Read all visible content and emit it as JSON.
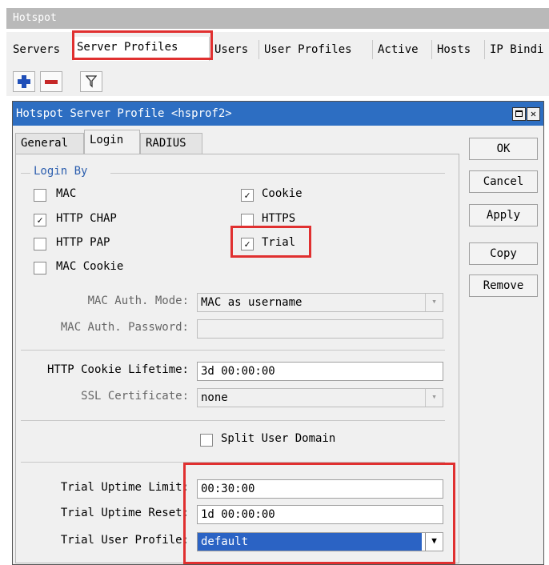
{
  "parent_window": {
    "title": "Hotspot",
    "tabs": [
      "Servers",
      "Server Profiles",
      "Users",
      "User Profiles",
      "Active",
      "Hosts",
      "IP Bindi"
    ],
    "active_tab": "Server Profiles"
  },
  "dialog": {
    "title": "Hotspot Server Profile <hsprof2>",
    "tabs": [
      "General",
      "Login",
      "RADIUS"
    ],
    "active_tab": "Login",
    "buttons": {
      "ok": "OK",
      "cancel": "Cancel",
      "apply": "Apply",
      "copy": "Copy",
      "remove": "Remove"
    }
  },
  "login": {
    "group_label": "Login By",
    "checkboxes": {
      "mac": {
        "label": "MAC",
        "checked": false
      },
      "http_chap": {
        "label": "HTTP CHAP",
        "checked": true
      },
      "http_pap": {
        "label": "HTTP PAP",
        "checked": false
      },
      "mac_cookie": {
        "label": "MAC Cookie",
        "checked": false
      },
      "cookie": {
        "label": "Cookie",
        "checked": true
      },
      "https": {
        "label": "HTTPS",
        "checked": false
      },
      "trial": {
        "label": "Trial",
        "checked": true
      }
    },
    "fields": {
      "mac_auth_mode": {
        "label": "MAC Auth. Mode:",
        "value": "MAC as username"
      },
      "mac_auth_password": {
        "label": "MAC Auth. Password:",
        "value": ""
      },
      "http_cookie_lifetime": {
        "label": "HTTP Cookie Lifetime:",
        "value": "3d 00:00:00"
      },
      "ssl_certificate": {
        "label": "SSL Certificate:",
        "value": "none"
      },
      "split_user_domain": {
        "label": "Split User Domain",
        "checked": false
      },
      "trial_uptime_limit": {
        "label": "Trial Uptime Limit:",
        "value": "00:30:00"
      },
      "trial_uptime_reset": {
        "label": "Trial Uptime Reset:",
        "value": "1d 00:00:00"
      },
      "trial_user_profile": {
        "label": "Trial User Profile:",
        "value": "default"
      }
    }
  },
  "colors": {
    "title_bar": "#2d6ec2",
    "highlight_box": "#e03030",
    "add_icon": "#1f4fb8",
    "remove_icon": "#c62828",
    "selected_field": "#2b63c4"
  },
  "icons": [
    "plus-icon",
    "minus-icon",
    "filter-icon",
    "maximize-icon",
    "close-icon",
    "dropdown-arrow-icon",
    "checkmark-icon"
  ]
}
